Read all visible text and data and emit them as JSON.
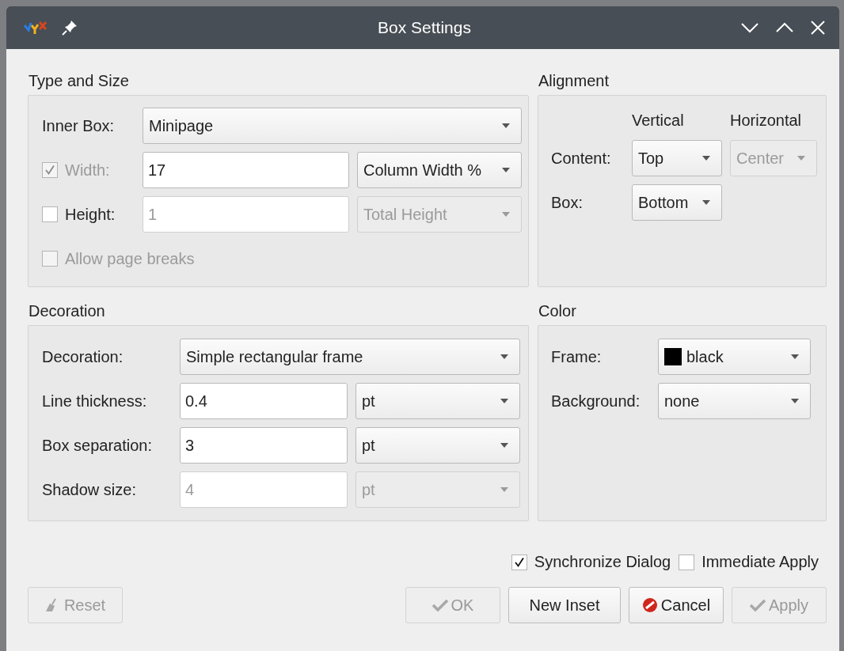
{
  "window": {
    "title": "Box Settings"
  },
  "type_and_size": {
    "title": "Type and Size",
    "rows": [
      {
        "kind": "select",
        "label": "Inner Box:",
        "value": "Minipage"
      },
      {
        "kind": "check_field",
        "label": "Width:",
        "checked": true,
        "label_disabled": true,
        "value": "17",
        "value_disabled": false,
        "unit": "Column Width %",
        "unit_disabled": false
      },
      {
        "kind": "check_field",
        "label": "Height:",
        "checked": false,
        "label_disabled": false,
        "value": "1",
        "value_disabled": true,
        "unit": "Total Height",
        "unit_disabled": true
      },
      {
        "kind": "checkbox",
        "label": "Allow page breaks",
        "checked": false,
        "disabled": true
      }
    ]
  },
  "alignment": {
    "title": "Alignment",
    "columns": [
      "Vertical",
      "Horizontal"
    ],
    "rows": [
      {
        "label": "Content:",
        "vertical": {
          "value": "Top",
          "disabled": false
        },
        "horizontal": {
          "value": "Center",
          "disabled": true
        }
      },
      {
        "label": "Box:",
        "vertical": {
          "value": "Bottom",
          "disabled": false
        }
      }
    ]
  },
  "decoration": {
    "title": "Decoration",
    "rows": [
      {
        "kind": "select",
        "label": "Decoration:",
        "value": "Simple rectangular frame"
      },
      {
        "kind": "field_unit",
        "label": "Line thickness:",
        "value": "0.4",
        "unit": "pt",
        "disabled": false
      },
      {
        "kind": "field_unit",
        "label": "Box separation:",
        "value": "3",
        "unit": "pt",
        "disabled": false
      },
      {
        "kind": "field_unit",
        "label": "Shadow size:",
        "value": "4",
        "unit": "pt",
        "disabled": true
      }
    ]
  },
  "color": {
    "title": "Color",
    "rows": [
      {
        "label": "Frame:",
        "value": "black",
        "color": "#000000"
      },
      {
        "label": "Background:",
        "value": "none"
      }
    ]
  },
  "options": [
    {
      "label": "Synchronize Dialog",
      "checked": true
    },
    {
      "label": "Immediate Apply",
      "checked": false
    }
  ],
  "buttons": [
    {
      "kind": "reset",
      "label": "Reset",
      "disabled": true
    },
    {
      "kind": "ok",
      "label": "OK",
      "disabled": true
    },
    {
      "kind": "plain",
      "label": "New Inset",
      "disabled": false
    },
    {
      "kind": "cancel",
      "label": "Cancel",
      "disabled": false
    },
    {
      "kind": "apply",
      "label": "Apply",
      "disabled": true
    }
  ]
}
